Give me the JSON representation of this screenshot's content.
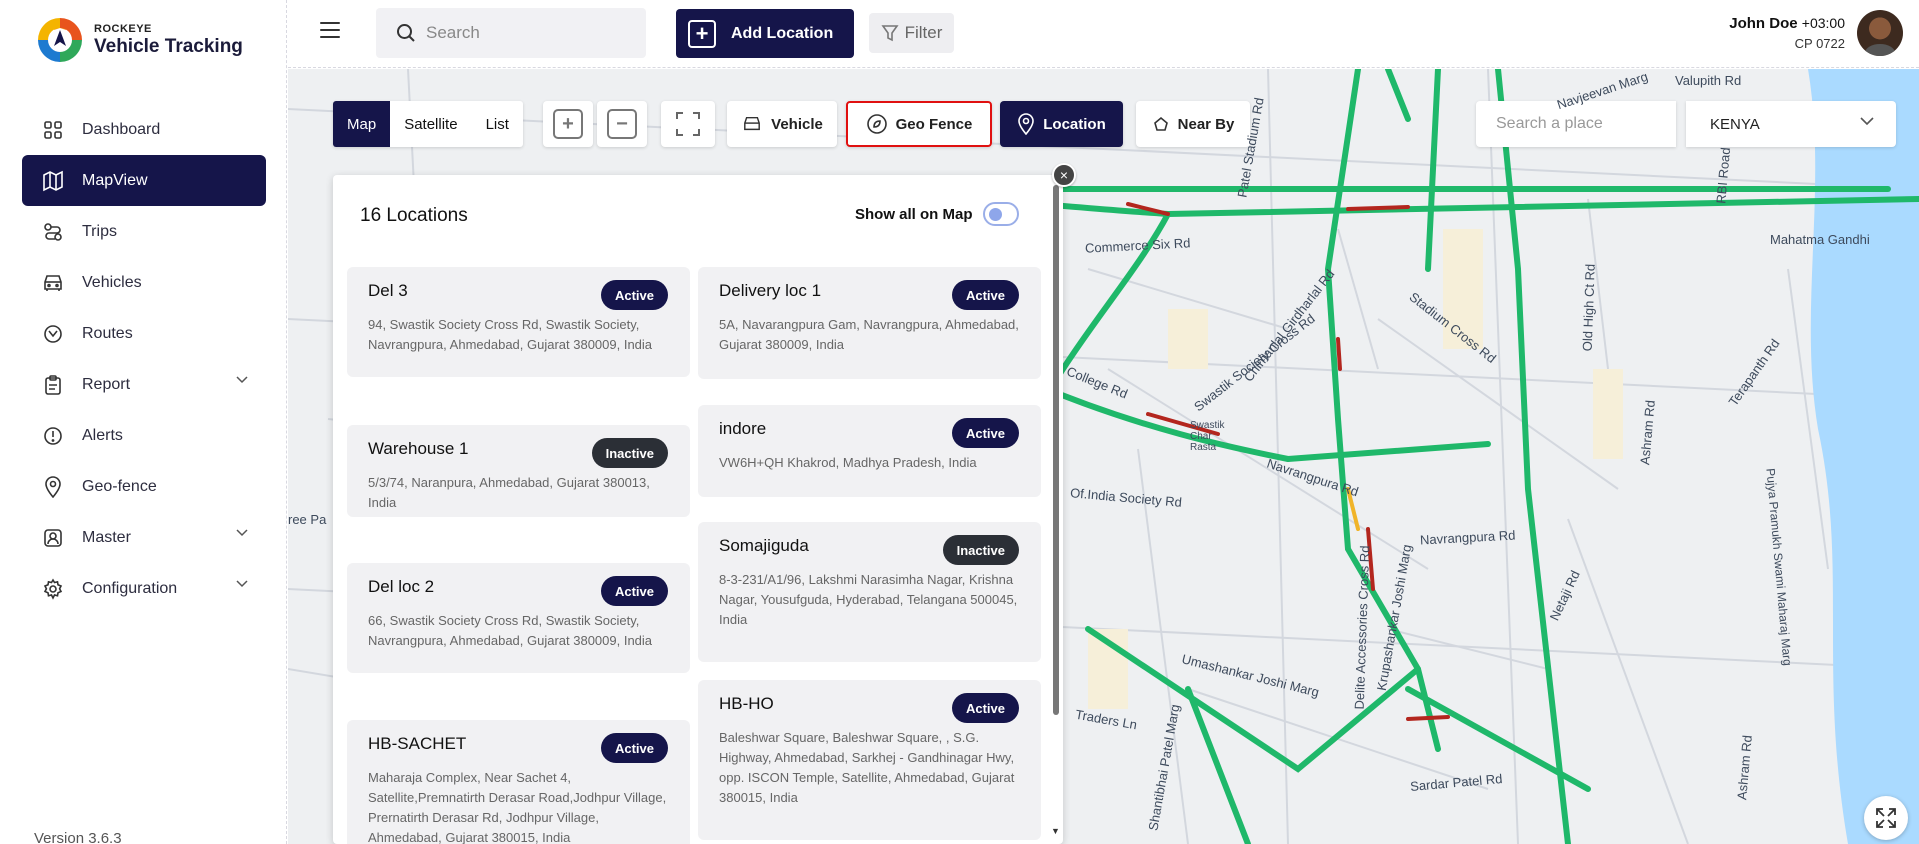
{
  "brand": {
    "small": "ROCKEYE",
    "big": "Vehicle Tracking"
  },
  "sidebar": {
    "items": [
      {
        "label": "Dashboard",
        "icon": "dashboard-icon"
      },
      {
        "label": "MapView",
        "icon": "map-icon",
        "active": true
      },
      {
        "label": "Trips",
        "icon": "trips-icon"
      },
      {
        "label": "Vehicles",
        "icon": "vehicle-icon"
      },
      {
        "label": "Routes",
        "icon": "routes-icon"
      },
      {
        "label": "Report",
        "icon": "report-icon",
        "expandable": true
      },
      {
        "label": "Alerts",
        "icon": "alert-icon"
      },
      {
        "label": "Geo-fence",
        "icon": "geofence-icon"
      },
      {
        "label": "Master",
        "icon": "master-icon",
        "expandable": true
      },
      {
        "label": "Configuration",
        "icon": "gear-icon",
        "expandable": true
      }
    ],
    "version": "Version 3.6.3"
  },
  "topbar": {
    "search_placeholder": "Search",
    "add_location": "Add Location",
    "filter": "Filter",
    "user_name": "John Doe",
    "user_tz": "+03:00",
    "user_sub": "CP 0722"
  },
  "map_controls": {
    "view_tabs": [
      "Map",
      "Satellite",
      "List"
    ],
    "selected_view": "Map",
    "vehicle": "Vehicle",
    "geo_fence": "Geo Fence",
    "location": "Location",
    "near_by": "Near By",
    "place_placeholder": "Search a place",
    "country": "KENYA"
  },
  "panel": {
    "title": "16 Locations",
    "show_all": "Show all on Map",
    "left_cards": [
      {
        "name": "Del 3",
        "status": "Active",
        "address": "94, Swastik Society Cross Rd, Swastik Society, Navrangpura, Ahmedabad, Gujarat 380009, India"
      },
      {
        "name": "Warehouse 1",
        "status": "Inactive",
        "address": "5/3/74, Naranpura, Ahmedabad, Gujarat 380013, India"
      },
      {
        "name": "Del loc 2",
        "status": "Active",
        "address": "66, Swastik Society Cross Rd, Swastik Society, Navrangpura, Ahmedabad, Gujarat 380009, India"
      },
      {
        "name": "HB-SACHET",
        "status": "Active",
        "address": "Maharaja Complex, Near Sachet 4, Satellite,Premnatirth Derasar Road,Jodhpur Village, Prernatirth Derasar Rd, Jodhpur Village, Ahmedabad, Gujarat 380015, India"
      }
    ],
    "right_cards": [
      {
        "name": "Delivery loc 1",
        "status": "Active",
        "address": "5A, Navarangpura Gam, Navrangpura, Ahmedabad, Gujarat 380009, India"
      },
      {
        "name": "indore",
        "status": "Active",
        "address": "VW6H+QH Khakrod, Madhya Pradesh, India"
      },
      {
        "name": "Somajiguda",
        "status": "Inactive",
        "address": "8-3-231/A1/96, Lakshmi Narasimha Nagar, Krishna Nagar, Yousufguda, Hyderabad, Telangana 500045, India"
      },
      {
        "name": "HB-HO",
        "status": "Active",
        "address": "Baleshwar Square, Baleshwar Square, , S.G. Highway, Ahmedabad, Sarkhej - Gandhinagar Hwy, opp. ISCON Temple, Satellite, Ahmedabad, Gujarat 380015, India"
      }
    ]
  },
  "map_labels": [
    "Commerce Six Rd",
    "Mahatma Gandhi",
    "Stadium Cross Rd",
    "Chimanlal Girdharlal Rd",
    "Swastik Society Cross Rd",
    "College Rd",
    "Navrangpura Rd",
    "Navrangpura Rd",
    "Of.India Society Rd",
    "Swastik Char Rasta",
    "Old High Ct Rd",
    "RBI Road",
    "Terapanth Rd",
    "Ashram Rd",
    "Netaji Rd",
    "Pujya Pramukh Swami Maharaj Marg",
    "Umashankar Joshi Marg",
    "Krupashankar Joshi Marg",
    "Delite Accessories Cross Rd",
    "Sardar Patel Rd",
    "Traders Ln",
    "Shantibhai Patel Marg",
    "Navjeevan Marg",
    "Valupith Rd",
    "Patel Stadium Rd",
    "Ashram Rd",
    "ree Pa"
  ],
  "colors": {
    "primary": "#15154a",
    "road_green": "#1fb86a",
    "road_red": "#b3261e",
    "water": "#aadaff"
  }
}
